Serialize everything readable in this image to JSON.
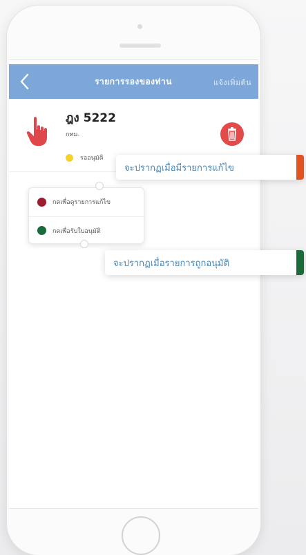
{
  "navbar": {
    "title": "รายการรองของท่าน",
    "action_label": "แจ้งเพิ่มต้น",
    "background": "#7ca7d8"
  },
  "item": {
    "plate": "ฎง 5222",
    "province": "กทม.",
    "status_label": "รออนุมัติ",
    "status_color": "#f6d32b",
    "icons": [
      "hand-pointer-icon",
      "trash-icon"
    ]
  },
  "menu": {
    "items": [
      {
        "label": "กดเพื่อดูรายการแก้ไข",
        "color": "#9b1c2e"
      },
      {
        "label": "กดเพื่อรับใบอนุมัติ",
        "color": "#1b6b3a"
      }
    ]
  },
  "callouts": [
    {
      "text": "จะปรากฏเมื่อมีรายการแก้ไข",
      "color": "#e2531f"
    },
    {
      "text": "จะปรากฏเมื่อรายการถูกอนุมัติ",
      "color": "#1b6b3a"
    }
  ]
}
